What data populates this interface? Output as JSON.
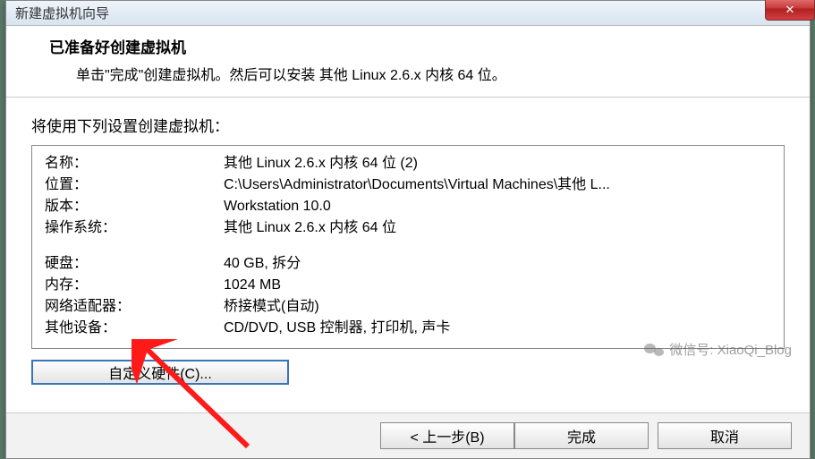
{
  "window": {
    "title": "新建虚拟机向导"
  },
  "header": {
    "title": "已准备好创建虚拟机",
    "subtitle": "单击\"完成\"创建虚拟机。然后可以安装 其他 Linux 2.6.x 内核 64 位。"
  },
  "intro": "将使用下列设置创建虚拟机：",
  "summary": {
    "name_label": "名称：",
    "name_value": "其他 Linux 2.6.x 内核 64 位 (2)",
    "location_label": "位置：",
    "location_value": "C:\\Users\\Administrator\\Documents\\Virtual Machines\\其他 L...",
    "version_label": "版本：",
    "version_value": "Workstation 10.0",
    "os_label": "操作系统：",
    "os_value": "其他 Linux 2.6.x 内核 64 位",
    "disk_label": "硬盘：",
    "disk_value": "40 GB, 拆分",
    "memory_label": "内存：",
    "memory_value": "1024 MB",
    "network_label": "网络适配器：",
    "network_value": "桥接模式(自动)",
    "other_label": "其他设备：",
    "other_value": "CD/DVD, USB 控制器, 打印机, 声卡"
  },
  "buttons": {
    "customize": "自定义硬件(C)...",
    "back": "< 上一步(B)",
    "finish": "完成",
    "cancel": "取消"
  },
  "watermark": "微信号: XiaoQi_Blog"
}
